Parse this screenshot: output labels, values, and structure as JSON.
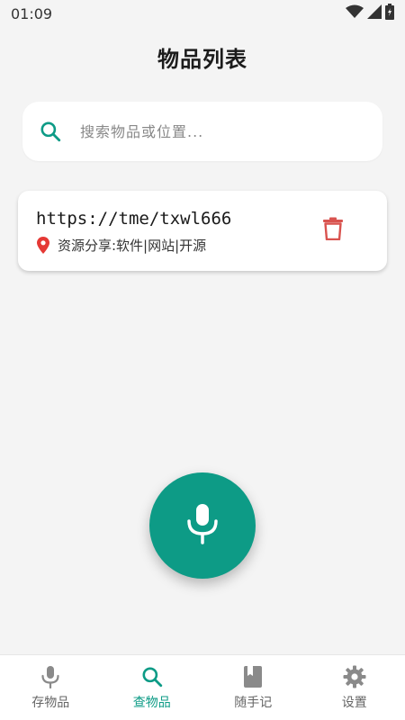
{
  "status_bar": {
    "time": "01:09"
  },
  "header": {
    "title": "物品列表"
  },
  "search": {
    "placeholder": "搜索物品或位置...",
    "value": ""
  },
  "items": [
    {
      "name": "https://tme/txwl666",
      "location": "资源分享:软件|网站|开源",
      "location_icon": "pin-icon",
      "delete_icon": "trash-icon"
    }
  ],
  "fab": {
    "icon": "microphone-icon"
  },
  "bottom_nav": {
    "items": [
      {
        "label": "存物品",
        "icon": "microphone-icon",
        "active": false
      },
      {
        "label": "查物品",
        "icon": "search-icon",
        "active": true
      },
      {
        "label": "随手记",
        "icon": "book-icon",
        "active": false
      },
      {
        "label": "设置",
        "icon": "gear-icon",
        "active": false
      }
    ]
  },
  "colors": {
    "accent": "#0d9b86",
    "delete": "#d9534f",
    "inactive": "#8a8a8a",
    "background": "#f4f4f4"
  }
}
